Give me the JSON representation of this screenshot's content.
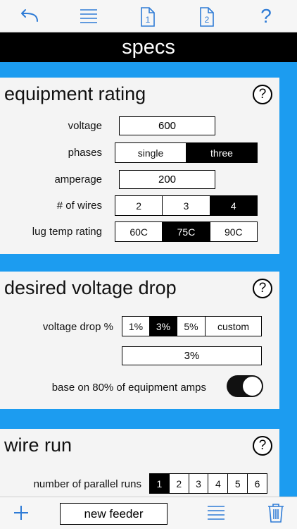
{
  "toolbar": {
    "back_icon": "undo-arrow-icon",
    "menu_icon": "list-icon",
    "page1_label": "1",
    "page2_label": "2",
    "help_label": "?"
  },
  "title": "specs",
  "equipment": {
    "heading": "equipment rating",
    "help": "?",
    "voltage_label": "voltage",
    "voltage_value": "600",
    "phases_label": "phases",
    "phases_options": [
      "single",
      "three"
    ],
    "amperage_label": "amperage",
    "amperage_value": "200",
    "wires_label": "# of wires",
    "wires_options": [
      "2",
      "3",
      "4"
    ],
    "lug_label": "lug temp rating",
    "lug_options": [
      "60C",
      "75C",
      "90C"
    ]
  },
  "drop": {
    "heading": "desired voltage drop",
    "help": "?",
    "vd_label": "voltage drop %",
    "vd_options": [
      "1%",
      "3%",
      "5%",
      "custom"
    ],
    "vd_value": "3%",
    "base_label": "base on 80% of equipment amps",
    "base_on": true
  },
  "wirerun": {
    "heading": "wire run",
    "help": "?",
    "parallel_label": "number of parallel runs",
    "parallel_options": [
      "1",
      "2",
      "3",
      "4",
      "5",
      "6"
    ]
  },
  "bottom": {
    "add_icon": "plus-icon",
    "new_feeder": "new feeder",
    "list_icon": "list-icon",
    "trash_icon": "trash-icon"
  },
  "colors": {
    "accent": "#1c9cf0",
    "icon_blue": "#2e7bd6"
  }
}
